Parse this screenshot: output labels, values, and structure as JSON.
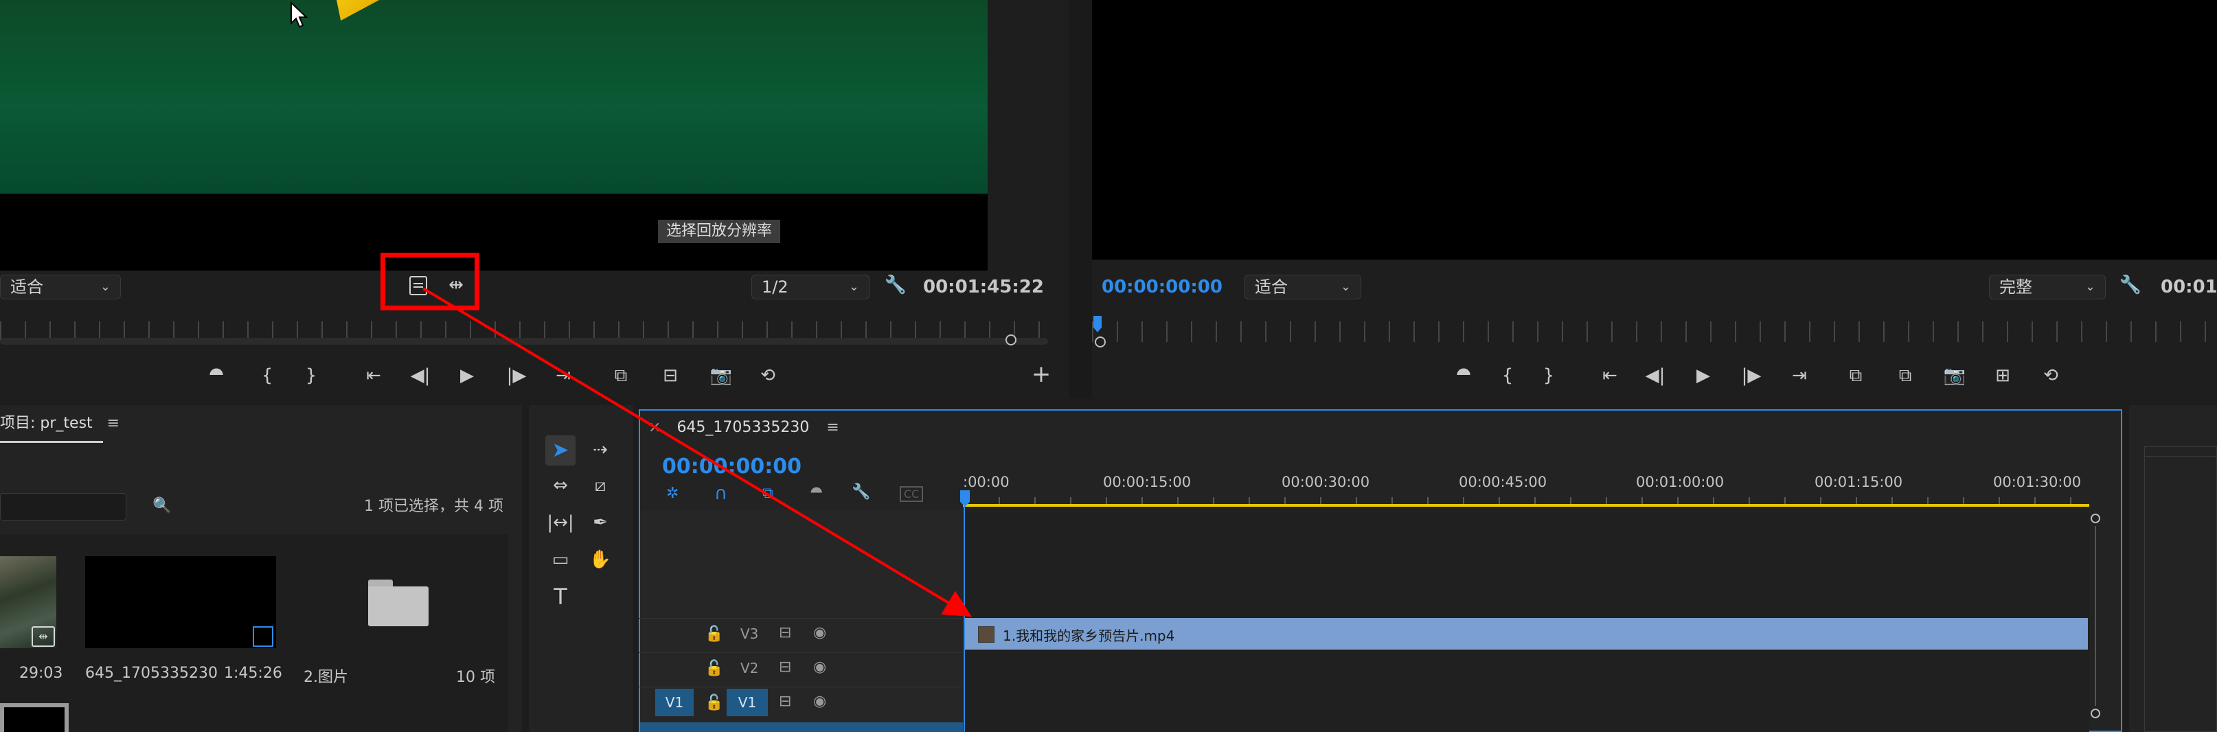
{
  "source_monitor": {
    "zoom_select": "适合",
    "resolution_select": "1/2",
    "tooltip": "选择回放分辨率",
    "timecode": "00:01:45:22",
    "highlight_color": "#ff0000"
  },
  "program_monitor": {
    "timecode": "00:00:00:00",
    "zoom_select": "适合",
    "quality_select": "完整",
    "timecode_partial": "00:01:"
  },
  "project": {
    "tab_label": "项目: pr_test",
    "selection_status": "1 项已选择，共 4 项",
    "items": [
      {
        "name": "",
        "duration": "29:03"
      },
      {
        "name": "645_1705335230",
        "duration": "1:45:26"
      },
      {
        "name": "2.图片",
        "duration": "10 项"
      }
    ]
  },
  "timeline": {
    "sequence_name": "645_1705335230",
    "timecode": "00:00:00:00",
    "ruler_labels": [
      ":00:00",
      "00:00:15:00",
      "00:00:30:00",
      "00:00:45:00",
      "00:01:00:00",
      "00:01:15:00",
      "00:01:30:00"
    ],
    "tracks": [
      {
        "name": "V3",
        "source": ""
      },
      {
        "name": "V2",
        "source": ""
      },
      {
        "name": "V1",
        "source": "V1"
      }
    ],
    "clip_label": "1.我和我的家乡预告片.mp4",
    "clip_color": "#7a9fd0",
    "playhead_color": "#2d8ceb"
  }
}
